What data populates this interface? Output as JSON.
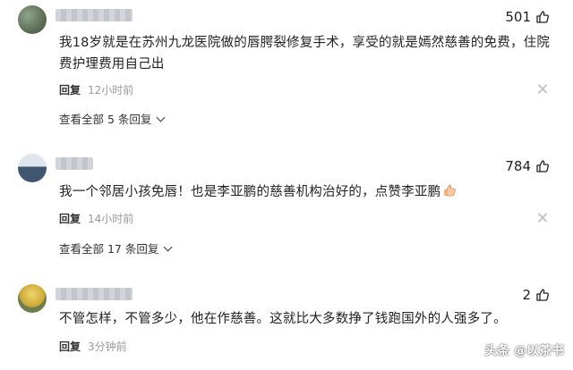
{
  "comments": [
    {
      "likes": "501",
      "text": "我18岁就是在苏州九龙医院做的唇腭裂修复手术，享受的就是嫣然慈善的免费，住院费护理费用自己出",
      "reply_label": "回复",
      "time": "12小时前",
      "view_replies": "查看全部 5 条回复"
    },
    {
      "likes": "784",
      "text": "我一个邻居小孩免唇！也是李亚鹏的慈善机构治好的，点赞李亚鹏",
      "reply_label": "回复",
      "time": "14小时前",
      "view_replies": "查看全部 17 条回复"
    },
    {
      "likes": "2",
      "text": "不管怎样，不管多少，他在作慈善。这就比大多数挣了钱跑国外的人强多了。",
      "reply_label": "回复",
      "time": "3分钟前"
    }
  ],
  "watermark": "头条 @以茶书",
  "icons": {
    "like": "thumbs-up-icon",
    "dismiss": "close-icon",
    "expand": "chevron-down-icon",
    "emoji": "thumbs-up-emoji"
  },
  "colors": {
    "text": "#222222",
    "muted": "#999999",
    "close": "#c4c4c4"
  }
}
